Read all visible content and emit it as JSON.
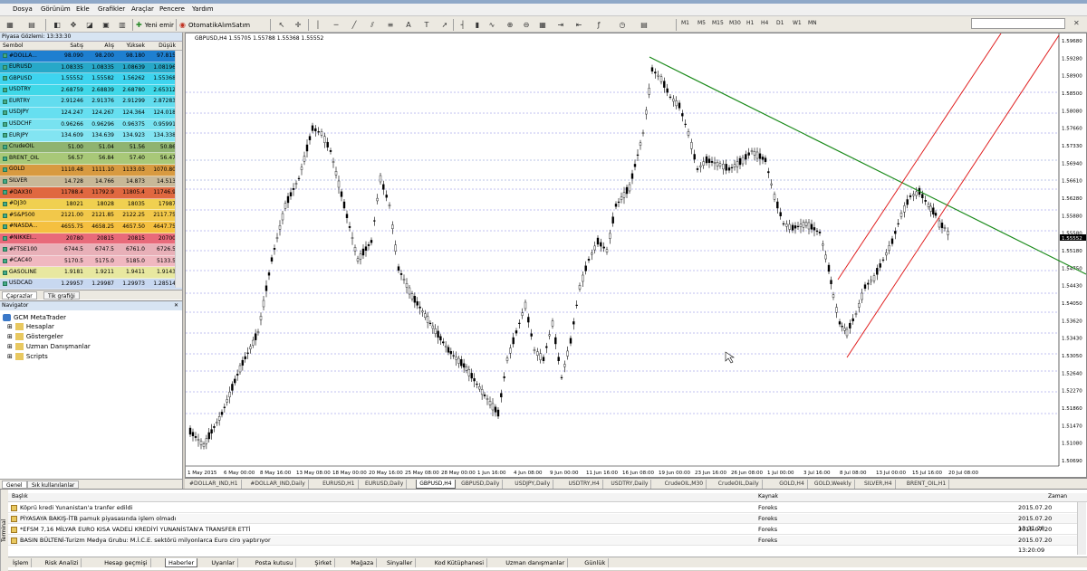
{
  "window_title": "GBPUSD,H4",
  "menu": [
    "Dosya",
    "Görünüm",
    "Ekle",
    "Grafikler",
    "Araçlar",
    "Pencere",
    "Yardım"
  ],
  "toolbar": {
    "new_order": "Yeni emir",
    "auto_trading": "OtomatikAlımSatım",
    "timeframes": [
      "M1",
      "M5",
      "M15",
      "M30",
      "H1",
      "H4",
      "D1",
      "W1",
      "MN"
    ]
  },
  "market_watch": {
    "title": "Piyasa Gözlemi: 13:33:30",
    "headers": [
      "Sembol",
      "Satış",
      "Alış",
      "Yüksek",
      "Düşük"
    ],
    "rows": [
      {
        "sym": "#DOLLA...",
        "bid": "98.090",
        "ask": "98.200",
        "high": "98.180",
        "low": "97.815",
        "color": "#1e7fd0"
      },
      {
        "sym": "EURUSD",
        "bid": "1.08335",
        "ask": "1.08335",
        "high": "1.08639",
        "low": "1.08196",
        "color": "#27a8c8"
      },
      {
        "sym": "GBPUSD",
        "bid": "1.55552",
        "ask": "1.55582",
        "high": "1.56262",
        "low": "1.55368",
        "color": "#3ed4ef"
      },
      {
        "sym": "USDTRY",
        "bid": "2.68759",
        "ask": "2.68839",
        "high": "2.68780",
        "low": "2.65312",
        "color": "#40d8e8"
      },
      {
        "sym": "EURTRY",
        "bid": "2.91246",
        "ask": "2.91376",
        "high": "2.91299",
        "low": "2.87283",
        "color": "#62dcee"
      },
      {
        "sym": "USDJPY",
        "bid": "124.247",
        "ask": "124.267",
        "high": "124.364",
        "low": "124.018",
        "color": "#66dff0"
      },
      {
        "sym": "USDCHF",
        "bid": "0.96266",
        "ask": "0.96296",
        "high": "0.96375",
        "low": "0.95991",
        "color": "#78e2f0"
      },
      {
        "sym": "EURJPY",
        "bid": "134.609",
        "ask": "134.639",
        "high": "134.923",
        "low": "134.338",
        "color": "#82e4f2"
      },
      {
        "sym": "CrudeOIL",
        "bid": "51.00",
        "ask": "51.04",
        "high": "51.56",
        "low": "50.86",
        "color": "#8fb370"
      },
      {
        "sym": "BRENT_OIL",
        "bid": "56.57",
        "ask": "56.84",
        "high": "57.40",
        "low": "56.47",
        "color": "#a8c878"
      },
      {
        "sym": "GOLD",
        "bid": "1110.48",
        "ask": "1111.10",
        "high": "1133.03",
        "low": "1070.80",
        "color": "#d89a40"
      },
      {
        "sym": "SILVER",
        "bid": "14.728",
        "ask": "14.766",
        "high": "14.873",
        "low": "14.513",
        "color": "#c8b898"
      },
      {
        "sym": "#DAX30",
        "bid": "11788.4",
        "ask": "11792.9",
        "high": "11805.4",
        "low": "11746.9",
        "color": "#e06840"
      },
      {
        "sym": "#DJ30",
        "bid": "18021",
        "ask": "18028",
        "high": "18035",
        "low": "17987",
        "color": "#f0d050"
      },
      {
        "sym": "#S&P500",
        "bid": "2121.00",
        "ask": "2121.85",
        "high": "2122.25",
        "low": "2117.75",
        "color": "#f2c84a"
      },
      {
        "sym": "#NASDA...",
        "bid": "4655.75",
        "ask": "4658.25",
        "high": "4657.50",
        "low": "4647.75",
        "color": "#f5c040"
      },
      {
        "sym": "#NIKKEI...",
        "bid": "20780",
        "ask": "20815",
        "high": "20815",
        "low": "20700",
        "color": "#e86a7a"
      },
      {
        "sym": "#FTSE100",
        "bid": "6744.5",
        "ask": "6747.5",
        "high": "6761.0",
        "low": "6726.5",
        "color": "#e8b0b8"
      },
      {
        "sym": "#CAC40",
        "bid": "5170.5",
        "ask": "5175.0",
        "high": "5185.0",
        "low": "5133.5",
        "color": "#f0b8c0"
      },
      {
        "sym": "GASOLINE",
        "bid": "1.9181",
        "ask": "1.9211",
        "high": "1.9411",
        "low": "1.9143",
        "color": "#e8e8a0"
      },
      {
        "sym": "USDCAD",
        "bid": "1.29957",
        "ask": "1.29987",
        "high": "1.29973",
        "low": "1.28514",
        "color": "#c8d8f0"
      }
    ],
    "tabs": [
      "Çaprazlar",
      "Tik grafiği"
    ]
  },
  "navigator": {
    "title": "Navigator",
    "root": "GCM MetaTrader",
    "items": [
      "Hesaplar",
      "Göstergeler",
      "Uzman Danışmanlar",
      "Scripts"
    ],
    "tabs": [
      "Genel",
      "Sık kullanılanlar"
    ]
  },
  "chart": {
    "info": "GBPUSD,H4  1.55705 1.55788 1.55368 1.55552",
    "price_labels": [
      "1.59680",
      "1.59280",
      "1.58900",
      "1.58500",
      "1.58080",
      "1.57660",
      "1.57330",
      "1.56940",
      "1.56610",
      "1.56280",
      "1.55880",
      "1.55580",
      "1.55180",
      "1.54750",
      "1.54430",
      "1.54050",
      "1.53620",
      "1.53430",
      "1.53050",
      "1.52640",
      "1.52270",
      "1.51860",
      "1.51470",
      "1.51080",
      "1.50690"
    ],
    "date_labels": [
      "1 May 2015",
      "6 May 00:00",
      "8 May 16:00",
      "13 May 08:00",
      "18 May 00:00",
      "20 May 16:00",
      "25 May 08:00",
      "28 May 00:00",
      "1 Jun 16:00",
      "4 Jun 08:00",
      "9 Jun 00:00",
      "11 Jun 16:00",
      "16 Jun 08:00",
      "19 Jun 00:00",
      "23 Jun 16:00",
      "26 Jun 08:00",
      "1 Jul 00:00",
      "3 Jul 16:00",
      "8 Jul 08:00",
      "13 Jul 00:00",
      "15 Jul 16:00",
      "20 Jul 08:00"
    ],
    "current_price": "1.55552",
    "tabs": [
      "#DOLLAR_IND,H1",
      "#DOLLAR_IND,Daily",
      "EURUSD,H1",
      "EURUSD,Daily",
      "GBPUSD,H4",
      "GBPUSD,Daily",
      "USDJPY,Daily",
      "USDTRY,H4",
      "USDTRY,Daily",
      "CrudeOIL,M30",
      "CrudeOIL,Daily",
      "GOLD,H4",
      "GOLD,Weekly",
      "SILVER,H4",
      "BRENT_OIL,H1"
    ],
    "active_tab": "GBPUSD,H4"
  },
  "terminal": {
    "side_label": "Terminal",
    "headers": [
      "Başlık",
      "Kaynak",
      "Zaman"
    ],
    "rows": [
      {
        "title": "Köprü kredi Yunanistan'a tranfer edildi",
        "source": "Foreks",
        "time": "2015.07.20 13:32:11"
      },
      {
        "title": "PİYASAYA BAKIŞ-İTB pamuk piyasasında işlem olmadı",
        "source": "Foreks",
        "time": "2015.07.20 13:31:28"
      },
      {
        "title": "*EFSM 7,16 MİLYAR EURO KISA VADELİ KREDİYİ YUNANİSTAN'A TRANSFER ETTİ",
        "source": "Foreks",
        "time": "2015.07.20 13:30:19"
      },
      {
        "title": "BASIN BÜLTENİ-Turizm Medya Grubu: M.İ.C.E. sektörü milyonlarca Euro ciro yaptırıyor",
        "source": "Foreks",
        "time": "2015.07.20 13:20:09"
      }
    ],
    "tabs": [
      "İşlem",
      "Risk Analizi",
      "Hesap geçmişi",
      "Haberler",
      "Uyarılar",
      "Posta kutusu",
      "Şirket",
      "Mağaza",
      "Sinyaller",
      "Kod Kütüphanesi",
      "Uzman danışmanlar",
      "Günlük"
    ],
    "active_tab": "Haberler"
  }
}
